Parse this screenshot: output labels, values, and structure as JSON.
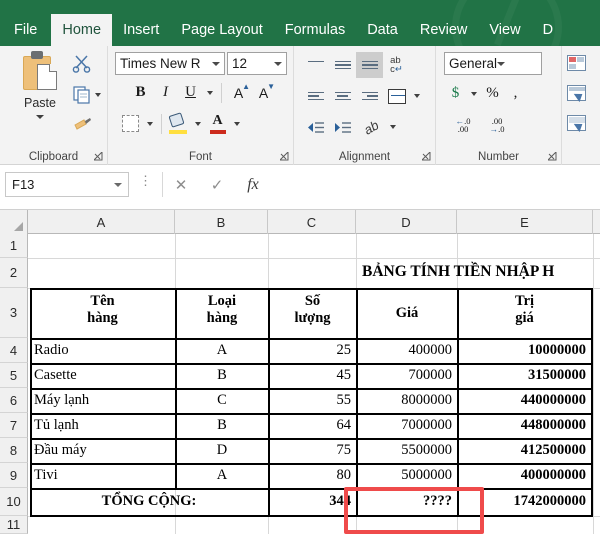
{
  "app": {
    "accent_green": "#217346",
    "highlight_red": "#ef4b4b"
  },
  "ribbon_tabs": [
    {
      "label": "File",
      "active": false
    },
    {
      "label": "Home",
      "active": true
    },
    {
      "label": "Insert",
      "active": false
    },
    {
      "label": "Page Layout",
      "active": false
    },
    {
      "label": "Formulas",
      "active": false
    },
    {
      "label": "Data",
      "active": false
    },
    {
      "label": "Review",
      "active": false
    },
    {
      "label": "View",
      "active": false
    },
    {
      "label": "D",
      "active": false
    }
  ],
  "groups": {
    "clipboard": {
      "label": "Clipboard",
      "paste_label": "Paste",
      "cut_icon": "scissors-icon",
      "copy_icon": "copy-icon",
      "format_painter_icon": "format-painter-icon"
    },
    "font": {
      "label": "Font",
      "font_name": "Times New R",
      "font_size": "12",
      "bold": "B",
      "italic": "I",
      "underline": "U",
      "grow_font": "A",
      "shrink_font": "A",
      "font_color_letter": "A"
    },
    "alignment": {
      "label": "Alignment",
      "wrap_text_top": "ab",
      "wrap_text_bottom": "c",
      "orientation_letter": "ab"
    },
    "number": {
      "label": "Number",
      "format": "General",
      "accounting": "$",
      "percent": "%",
      "comma": ",",
      "increase_decimal_top": ".0",
      "increase_decimal_bottom": ".00",
      "decrease_decimal_top": ".00",
      "decrease_decimal_bottom": ".0"
    },
    "styles": {
      "conditional_formatting_icon": "conditional-formatting-icon",
      "format_as_table_icon": "format-as-table-icon",
      "cell_styles_icon": "cell-styles-icon"
    }
  },
  "formula_bar": {
    "name_box": "F13",
    "cancel_icon": "cancel-icon",
    "enter_icon": "confirm-icon",
    "function_icon": "fx",
    "formula_value": ""
  },
  "sheet": {
    "columns": [
      "A",
      "B",
      "C",
      "D",
      "E"
    ],
    "rows": [
      "1",
      "2",
      "3",
      "4",
      "5",
      "6",
      "7",
      "8",
      "9",
      "10",
      "11"
    ],
    "title": "BẢNG TÍNH TIỀN NHẬP H",
    "headers": {
      "a_line1": "Tên",
      "a_line2": "hàng",
      "b_line1": "Loại",
      "b_line2": "hàng",
      "c_line1": "Số",
      "c_line2": "lượng",
      "d": "Giá",
      "e_line1": "Trị",
      "e_line2": "giá"
    },
    "data": [
      {
        "name": "Radio",
        "type": "A",
        "qty": "25",
        "price": "400000",
        "value": "10000000"
      },
      {
        "name": "Casette",
        "type": "B",
        "qty": "45",
        "price": "700000",
        "value": "31500000"
      },
      {
        "name": "Máy lạnh",
        "type": "C",
        "qty": "55",
        "price": "8000000",
        "value": "440000000"
      },
      {
        "name": "Tủ lạnh",
        "type": "B",
        "qty": "64",
        "price": "7000000",
        "value": "448000000"
      },
      {
        "name": "Đầu máy",
        "type": "D",
        "qty": "75",
        "price": "5500000",
        "value": "412500000"
      },
      {
        "name": "Tivi",
        "type": "A",
        "qty": "80",
        "price": "5000000",
        "value": "400000000"
      }
    ],
    "total": {
      "label": "TỔNG CỘNG:",
      "qty": "344",
      "price": "????",
      "value": "1742000000"
    }
  }
}
